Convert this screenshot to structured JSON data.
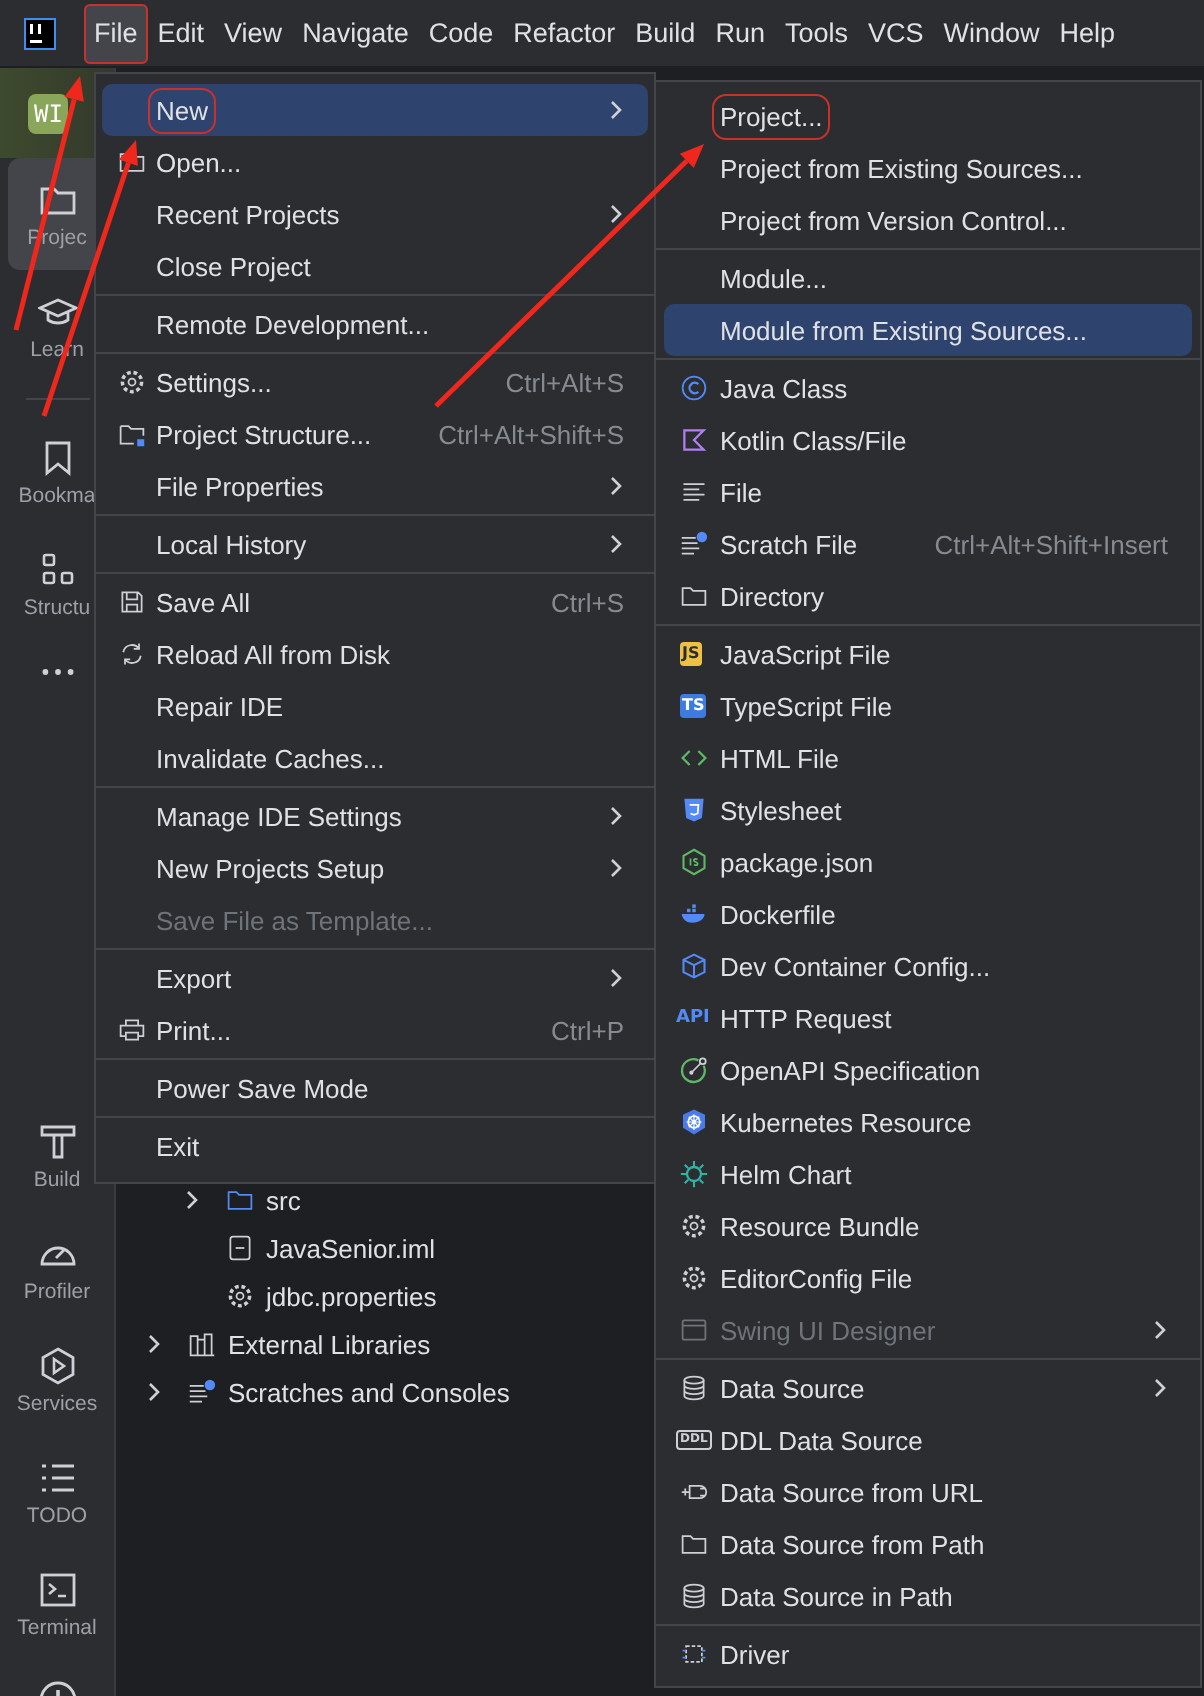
{
  "menu_bar": [
    {
      "label": "File",
      "selected": true,
      "outlined": true
    },
    {
      "label": "Edit",
      "selected": false,
      "outlined": false
    },
    {
      "label": "View",
      "selected": false,
      "outlined": false
    },
    {
      "label": "Navigate",
      "selected": false,
      "outlined": false
    },
    {
      "label": "Code",
      "selected": false,
      "outlined": false
    },
    {
      "label": "Refactor",
      "selected": false,
      "outlined": false
    },
    {
      "label": "Build",
      "selected": false,
      "outlined": false
    },
    {
      "label": "Run",
      "selected": false,
      "outlined": false
    },
    {
      "label": "Tools",
      "selected": false,
      "outlined": false
    },
    {
      "label": "VCS",
      "selected": false,
      "outlined": false
    },
    {
      "label": "Window",
      "selected": false,
      "outlined": false
    },
    {
      "label": "Help",
      "selected": false,
      "outlined": false
    }
  ],
  "project_badge": "WI",
  "tool_strip_top": [
    {
      "label": "Projec",
      "selected": true
    },
    {
      "label": "Learn",
      "selected": false
    },
    {
      "label": "Bookma",
      "selected": false
    },
    {
      "label": "Structu",
      "selected": false
    }
  ],
  "tool_strip_bottom": [
    {
      "label": "Build"
    },
    {
      "label": "Profiler"
    },
    {
      "label": "Services"
    },
    {
      "label": "TODO"
    },
    {
      "label": "Terminal"
    }
  ],
  "project_tree": [
    {
      "children": [
        {
          "label": "src",
          "expanded": false
        },
        {
          "label": "JavaSenior.iml"
        },
        {
          "label": "jdbc.properties"
        }
      ]
    },
    {
      "label": "External Libraries",
      "expanded": false
    },
    {
      "label": "Scratches and Consoles",
      "expanded": false
    }
  ],
  "file_menu": {
    "sections": [
      {
        "items": [
          {
            "label": "New",
            "submenu": true,
            "selected": true,
            "disabled": false,
            "outlined": true
          },
          {
            "label": "Open...",
            "submenu": false,
            "selected": false,
            "disabled": false,
            "outlined": false
          },
          {
            "label": "Recent Projects",
            "submenu": true,
            "selected": false,
            "disabled": false,
            "outlined": false
          },
          {
            "label": "Close Project",
            "submenu": false,
            "selected": false,
            "disabled": false,
            "outlined": false
          }
        ]
      },
      {
        "items": [
          {
            "label": "Remote Development...",
            "submenu": false,
            "selected": false,
            "disabled": false,
            "outlined": false
          }
        ]
      },
      {
        "items": [
          {
            "label": "Settings...",
            "shortcut": "Ctrl+Alt+S",
            "submenu": false,
            "selected": false,
            "disabled": false,
            "outlined": false
          },
          {
            "label": "Project Structure...",
            "shortcut": "Ctrl+Alt+Shift+S",
            "submenu": false,
            "selected": false,
            "disabled": false,
            "outlined": false
          },
          {
            "label": "File Properties",
            "submenu": true,
            "selected": false,
            "disabled": false,
            "outlined": false
          }
        ]
      },
      {
        "items": [
          {
            "label": "Local History",
            "submenu": true,
            "selected": false,
            "disabled": false,
            "outlined": false
          }
        ]
      },
      {
        "items": [
          {
            "label": "Save All",
            "shortcut": "Ctrl+S",
            "submenu": false,
            "selected": false,
            "disabled": false,
            "outlined": false
          },
          {
            "label": "Reload All from Disk",
            "submenu": false,
            "selected": false,
            "disabled": false,
            "outlined": false
          },
          {
            "label": "Repair IDE",
            "submenu": false,
            "selected": false,
            "disabled": false,
            "outlined": false
          },
          {
            "label": "Invalidate Caches...",
            "submenu": false,
            "selected": false,
            "disabled": false,
            "outlined": false
          }
        ]
      },
      {
        "items": [
          {
            "label": "Manage IDE Settings",
            "submenu": true,
            "selected": false,
            "disabled": false,
            "outlined": false
          },
          {
            "label": "New Projects Setup",
            "submenu": true,
            "selected": false,
            "disabled": false,
            "outlined": false
          },
          {
            "label": "Save File as Template...",
            "submenu": false,
            "selected": false,
            "disabled": true,
            "outlined": false
          }
        ]
      },
      {
        "items": [
          {
            "label": "Export",
            "submenu": true,
            "selected": false,
            "disabled": false,
            "outlined": false
          },
          {
            "label": "Print...",
            "shortcut": "Ctrl+P",
            "submenu": false,
            "selected": false,
            "disabled": false,
            "outlined": false
          }
        ]
      },
      {
        "items": [
          {
            "label": "Power Save Mode",
            "submenu": false,
            "selected": false,
            "disabled": false,
            "outlined": false
          }
        ]
      },
      {
        "items": [
          {
            "label": "Exit",
            "submenu": false,
            "selected": false,
            "disabled": false,
            "outlined": false
          }
        ]
      }
    ]
  },
  "new_submenu": {
    "sections": [
      {
        "items": [
          {
            "label": "Project...",
            "submenu": false,
            "selected": false,
            "disabled": false,
            "outlined": true
          },
          {
            "label": "Project from Existing Sources...",
            "submenu": false,
            "selected": false,
            "disabled": false,
            "outlined": false
          },
          {
            "label": "Project from Version Control...",
            "submenu": false,
            "selected": false,
            "disabled": false,
            "outlined": false
          }
        ]
      },
      {
        "items": [
          {
            "label": "Module...",
            "submenu": false,
            "selected": false,
            "disabled": false,
            "outlined": false
          },
          {
            "label": "Module from Existing Sources...",
            "submenu": false,
            "selected": true,
            "disabled": false,
            "outlined": false
          }
        ]
      },
      {
        "items": [
          {
            "label": "Java Class",
            "submenu": false,
            "selected": false,
            "disabled": false,
            "outlined": false
          },
          {
            "label": "Kotlin Class/File",
            "submenu": false,
            "selected": false,
            "disabled": false,
            "outlined": false
          },
          {
            "label": "File",
            "submenu": false,
            "selected": false,
            "disabled": false,
            "outlined": false
          },
          {
            "label": "Scratch File",
            "shortcut": "Ctrl+Alt+Shift+Insert",
            "submenu": false,
            "selected": false,
            "disabled": false,
            "outlined": false
          },
          {
            "label": "Directory",
            "submenu": false,
            "selected": false,
            "disabled": false,
            "outlined": false
          }
        ]
      },
      {
        "items": [
          {
            "label": "JavaScript File",
            "badge": "JS",
            "submenu": false,
            "selected": false,
            "disabled": false,
            "outlined": false
          },
          {
            "label": "TypeScript File",
            "badge": "TS",
            "submenu": false,
            "selected": false,
            "disabled": false,
            "outlined": false
          },
          {
            "label": "HTML File",
            "submenu": false,
            "selected": false,
            "disabled": false,
            "outlined": false
          },
          {
            "label": "Stylesheet",
            "submenu": false,
            "selected": false,
            "disabled": false,
            "outlined": false
          },
          {
            "label": "package.json",
            "submenu": false,
            "selected": false,
            "disabled": false,
            "outlined": false
          },
          {
            "label": "Dockerfile",
            "submenu": false,
            "selected": false,
            "disabled": false,
            "outlined": false
          },
          {
            "label": "Dev Container Config...",
            "submenu": false,
            "selected": false,
            "disabled": false,
            "outlined": false
          },
          {
            "label": "HTTP Request",
            "badge": "API",
            "submenu": false,
            "selected": false,
            "disabled": false,
            "outlined": false
          },
          {
            "label": "OpenAPI Specification",
            "submenu": false,
            "selected": false,
            "disabled": false,
            "outlined": false
          },
          {
            "label": "Kubernetes Resource",
            "submenu": false,
            "selected": false,
            "disabled": false,
            "outlined": false
          },
          {
            "label": "Helm Chart",
            "submenu": false,
            "selected": false,
            "disabled": false,
            "outlined": false
          },
          {
            "label": "Resource Bundle",
            "submenu": false,
            "selected": false,
            "disabled": false,
            "outlined": false
          },
          {
            "label": "EditorConfig File",
            "submenu": false,
            "selected": false,
            "disabled": false,
            "outlined": false
          },
          {
            "label": "Swing UI Designer",
            "submenu": true,
            "selected": false,
            "disabled": true,
            "outlined": false
          }
        ]
      },
      {
        "items": [
          {
            "label": "Data Source",
            "submenu": true,
            "selected": false,
            "disabled": false,
            "outlined": false
          },
          {
            "label": "DDL Data Source",
            "badge": "DDL",
            "submenu": false,
            "selected": false,
            "disabled": false,
            "outlined": false
          },
          {
            "label": "Data Source from URL",
            "submenu": false,
            "selected": false,
            "disabled": false,
            "outlined": false
          },
          {
            "label": "Data Source from Path",
            "submenu": false,
            "selected": false,
            "disabled": false,
            "outlined": false
          },
          {
            "label": "Data Source in Path",
            "submenu": false,
            "selected": false,
            "disabled": false,
            "outlined": false
          }
        ]
      },
      {
        "items": [
          {
            "label": "Driver",
            "submenu": false,
            "selected": false,
            "disabled": false,
            "outlined": false
          }
        ]
      }
    ]
  }
}
